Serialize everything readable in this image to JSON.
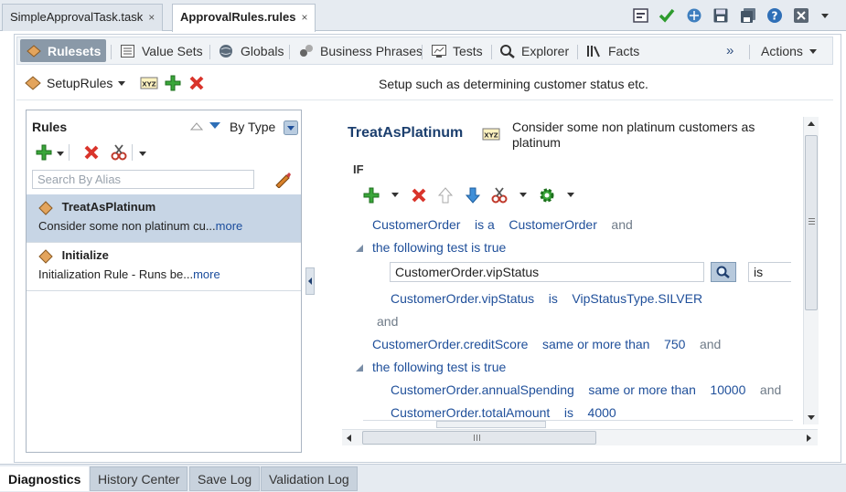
{
  "top_tabs": [
    {
      "label": "SimpleApprovalTask.task",
      "active": false
    },
    {
      "label": "ApprovalRules.rules",
      "active": true
    }
  ],
  "close_glyph": "×",
  "toolbar_icons": [
    "validate-icon",
    "check-icon",
    "deploy-icon",
    "save-icon",
    "save-all-icon",
    "help-icon",
    "close-window-icon",
    "menu-dropdown-icon"
  ],
  "sub_tabs": [
    {
      "label": "Rulesets",
      "icon": "ruleset-icon",
      "active": true
    },
    {
      "label": "Value Sets",
      "icon": "value-sets-icon"
    },
    {
      "label": "Globals",
      "icon": "globe-icon"
    },
    {
      "label": "Business Phrases",
      "icon": "business-phrases-icon"
    },
    {
      "label": "Tests",
      "icon": "tests-icon"
    },
    {
      "label": "Explorer",
      "icon": "search-icon"
    },
    {
      "label": "Facts",
      "icon": "facts-icon"
    }
  ],
  "overflow_glyph": "»",
  "actions_label": "Actions",
  "ruleset": {
    "name": "SetupRules",
    "description": "Setup such as determining customer status etc."
  },
  "rules_panel": {
    "title": "Rules",
    "sort_label": "By Type",
    "search_placeholder": "Search By Alias",
    "items": [
      {
        "name": "TreatAsPlatinum",
        "desc": "Consider some non platinum cu...",
        "more": "more",
        "selected": true
      },
      {
        "name": "Initialize",
        "desc": "Initialization Rule - Runs be...",
        "more": "more",
        "selected": false
      }
    ]
  },
  "rule_editor": {
    "name": "TreatAsPlatinum",
    "description": "Consider some non platinum customers as platinum",
    "if_label": "IF",
    "lines": {
      "l1a": "CustomerOrder",
      "l1b": "is a",
      "l1c": "CustomerOrder",
      "l1d": "and",
      "l2": "the following test is true",
      "l3_field": "CustomerOrder.vipStatus",
      "l3_op": "is",
      "l4a": "CustomerOrder.vipStatus",
      "l4b": "is",
      "l4c": "VipStatusType.SILVER",
      "l5": "and",
      "l6a": "CustomerOrder.creditScore",
      "l6b": "same or more than",
      "l6c": "750",
      "l6d": "and",
      "l7": "the following test is true",
      "l8a": "CustomerOrder.annualSpending",
      "l8b": "same or more than",
      "l8c": "10000",
      "l8d": "and",
      "l9a": "CustomerOrder.totalAmount",
      "l9b": "is",
      "l9c": "4000"
    }
  },
  "bottom_tabs": [
    {
      "label": "Diagnostics",
      "active": true
    },
    {
      "label": "History Center"
    },
    {
      "label": "Save Log"
    },
    {
      "label": "Validation Log"
    }
  ],
  "colors": {
    "accent": "#1f4f9a",
    "selected_row": "#c7d5e5",
    "active_subtab": "#8a99a8"
  }
}
